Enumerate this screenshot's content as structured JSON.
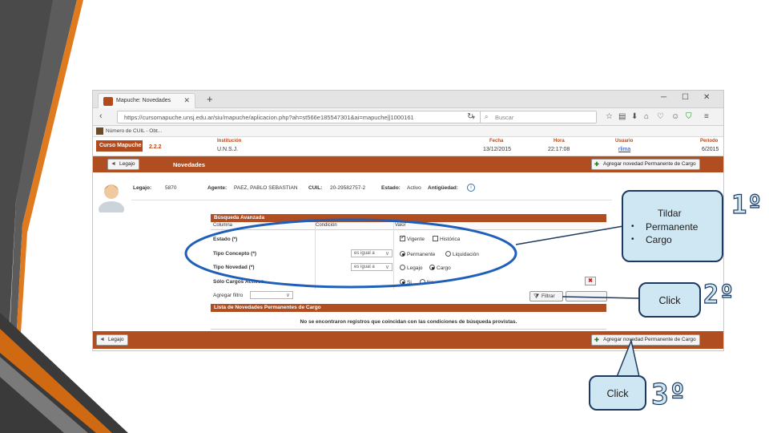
{
  "browser": {
    "tab_title": "Mapuche: Novedades",
    "url": "https://cursomapuche.unsj.edu.ar/siu/mapuche/aplicacion.php?ah=st566e185547301&ai=mapuche||1000161",
    "search_placeholder": "Buscar",
    "bookmark_label": "Número de CUIL - Obt..."
  },
  "header": {
    "logo": "Curso Mapuche",
    "version": "2.2.2",
    "fields": [
      {
        "label": "Institución",
        "value": "U.N.S.J."
      },
      {
        "label": "Fecha",
        "value": "13/12/2015"
      },
      {
        "label": "Hora",
        "value": "22:17:08"
      },
      {
        "label": "Usuario",
        "value": "rlima"
      },
      {
        "label": "Período",
        "value": "6/2015"
      }
    ]
  },
  "toolbar": {
    "back_label": "Legajo",
    "title": "Novedades",
    "add_label": "Agregar novedad Permanente de Cargo"
  },
  "employee": {
    "legajo_label": "Legajo:",
    "legajo_value": "5870",
    "agente_label": "Agente:",
    "agente_value": "PAEZ, PABLO SEBASTIAN",
    "cuil_label": "CUIL:",
    "cuil_value": "20-29582757-2",
    "estado_label": "Estado:",
    "estado_value": "Activo",
    "antiguedad_label": "Antigüedad:"
  },
  "search": {
    "title": "Búsqueda Avanzada",
    "columns": [
      "Columna",
      "Condición",
      "Valor"
    ],
    "rows": [
      {
        "label": "Estado (*)",
        "options": [
          {
            "text": "Vigente",
            "checked": true
          },
          {
            "text": "Histórica",
            "checked": false
          }
        ]
      },
      {
        "label": "Tipo Concepto (*)",
        "condition": "es igual a",
        "options": [
          {
            "text": "Permanente",
            "checked": true
          },
          {
            "text": "Liquidación",
            "checked": false
          }
        ]
      },
      {
        "label": "Tipo Novedad (*)",
        "condition": "es igual a",
        "options": [
          {
            "text": "Legajo",
            "checked": false
          },
          {
            "text": "Cargo",
            "checked": true
          }
        ]
      },
      {
        "label": "Sólo Cargos Activos",
        "options": [
          {
            "text": "Si",
            "checked": true
          },
          {
            "text": "No",
            "checked": false
          }
        ]
      }
    ],
    "add_filter_label": "Agregar filtro",
    "filter_button": "Filtrar"
  },
  "list": {
    "title": "Lista de Novedades Permanentes de Cargo",
    "empty_message": "No se encontraron registros que coincidan con las condiciones de búsqueda provistas."
  },
  "callouts": {
    "c1_items": [
      "Tildar",
      "Permanente",
      "Cargo"
    ],
    "c2": "Click",
    "c3": "Click",
    "step1": "1º",
    "step2": "2º",
    "step3": "3º"
  },
  "colors": {
    "accent": "#b04e22",
    "callout_fill": "#cfe7f3",
    "callout_border": "#1e3a5f",
    "highlight_ellipse": "#1f5fb8"
  }
}
